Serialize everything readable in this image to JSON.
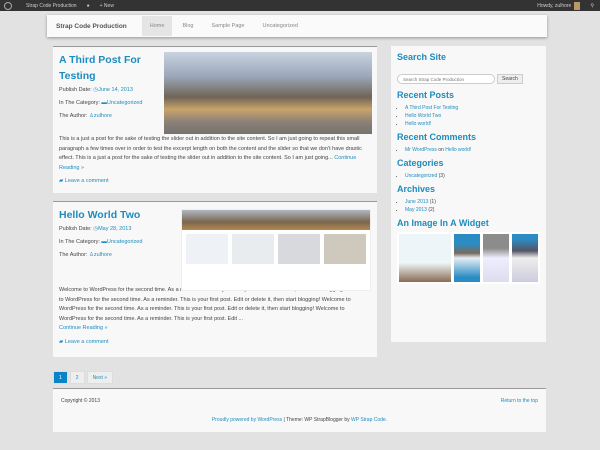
{
  "adminbar": {
    "site": "Strap Code Production",
    "new": "+ New",
    "howdy": "Howdy, zulhore"
  },
  "navbar": {
    "brand": "Strap Code Production",
    "items": [
      "Home",
      "Blog",
      "Sample Page",
      "Uncategorized"
    ]
  },
  "labels": {
    "publish": "Publish Date:",
    "category": "In The Category:",
    "author": "The Author:",
    "continue": "Continue Reading »",
    "leave_comment": "Leave a comment"
  },
  "posts": [
    {
      "title": "A Third Post For Testing",
      "date": "June 14, 2013",
      "category": "Uncategorized",
      "author": "zulhore",
      "excerpt": "This is a just a post for the sake of testing the slider out in addition to the site content. So I am just going to repeat this small paragraph a few times over in order to test the excerpt length on both the content and the slider so that we don't have drastic effect. This is a just a post for the sake of testing the slider out in addition to the site content. So I am just going..."
    },
    {
      "title": "Hello World Two",
      "date": "May 28, 2013",
      "category": "Uncategorized",
      "author": "zulhore",
      "excerpt": "Welcome to WordPress for the second time. As a reminder. This is your first post. Edit or delete it, then start blogging! Welcome to WordPress for the second time. As a reminder. This is your first post. Edit or delete it, then start blogging! Welcome to WordPress for the second time. As a reminder. This is your first post. Edit or delete it, then start blogging! Welcome to WordPress for the second time. As a reminder. This is your first post. Edit ..."
    }
  ],
  "sidebar": {
    "search_title": "Search Site",
    "search_placeholder": "Search Strap Code Production",
    "search_button": "Search",
    "recent_posts_title": "Recent Posts",
    "recent_posts": [
      "A Third Post For Testing",
      "Hello World Two",
      "Hello world!"
    ],
    "recent_comments_title": "Recent Comments",
    "comment_author": "Mr WordPress",
    "comment_on": "on",
    "comment_post": "Hello world!",
    "categories_title": "Categories",
    "category": "Uncategorized",
    "category_count": "(3)",
    "archives_title": "Archives",
    "archives": [
      {
        "label": "June 2013",
        "count": "(1)"
      },
      {
        "label": "May 2013",
        "count": "(2)"
      }
    ],
    "image_widget_title": "An Image In A Widget"
  },
  "pager": {
    "pages": [
      "1",
      "2"
    ],
    "next": "Next »"
  },
  "footer": {
    "copyright": "Copyright © 2013",
    "top": "Return to the top",
    "powered": "Proudly powered by WordPress",
    "sep": " | Theme: WP StrapBlogger by ",
    "theme_link": "WP Strap Code."
  }
}
